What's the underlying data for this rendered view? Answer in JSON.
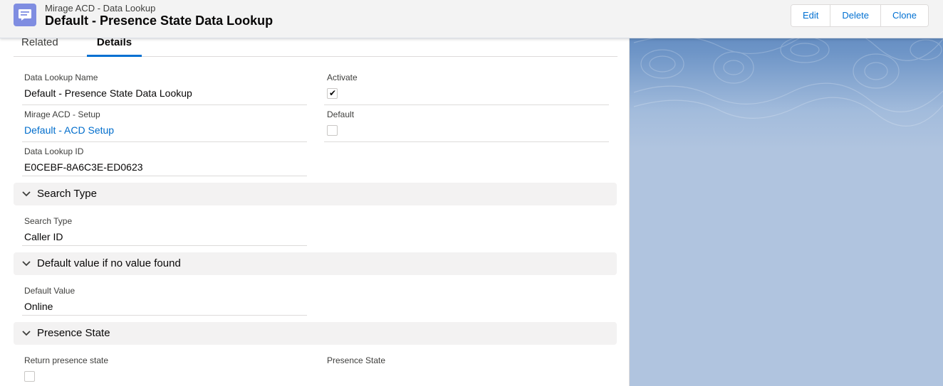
{
  "header": {
    "object_type": "Mirage ACD - Data Lookup",
    "record_title": "Default - Presence State Data Lookup",
    "icon": "record-icon",
    "actions": {
      "edit": "Edit",
      "delete": "Delete",
      "clone": "Clone"
    }
  },
  "tabs": {
    "related": "Related",
    "details": "Details",
    "active": "Details"
  },
  "fields": {
    "data_lookup_name": {
      "label": "Data Lookup Name",
      "value": "Default - Presence State Data Lookup"
    },
    "activate": {
      "label": "Activate",
      "checked": true
    },
    "setup": {
      "label": "Mirage ACD - Setup",
      "value": "Default - ACD Setup"
    },
    "default": {
      "label": "Default",
      "checked": false
    },
    "data_lookup_id": {
      "label": "Data Lookup ID",
      "value": "E0CEBF-8A6C3E-ED0623"
    }
  },
  "sections": {
    "search_type": {
      "title": "Search Type",
      "field_label": "Search Type",
      "field_value": "Caller ID"
    },
    "default_value": {
      "title": "Default value if no value found",
      "field_label": "Default Value",
      "field_value": "Online"
    },
    "presence_state": {
      "title": "Presence State",
      "return_label": "Return presence state",
      "return_checked": false,
      "state_label": "Presence State"
    }
  },
  "colors": {
    "brand_blue": "#0070d2",
    "link": "#006dcc",
    "icon_bg": "#7f8de1"
  }
}
